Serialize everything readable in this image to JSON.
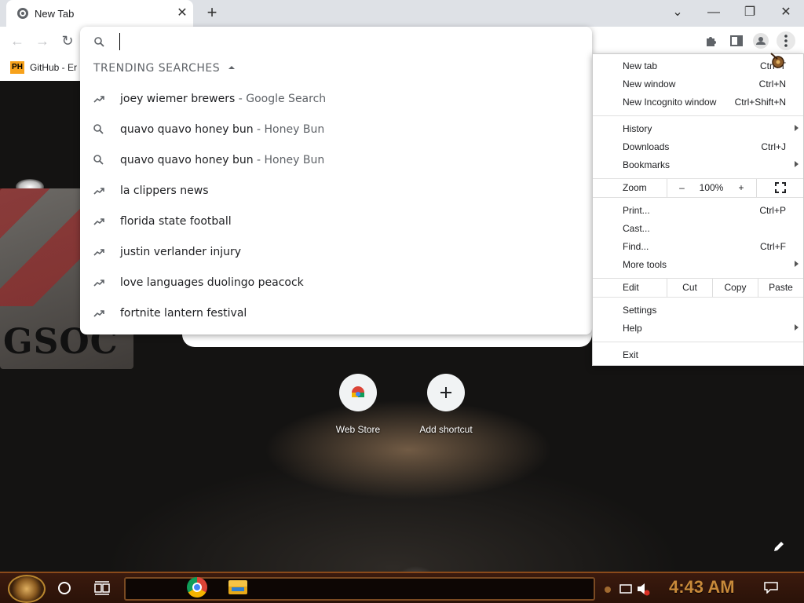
{
  "browser": {
    "tab": {
      "title": "New Tab",
      "close": "✕"
    },
    "new_tab_button": "+",
    "window_controls": {
      "tab_search": "⌄",
      "minimize": "—",
      "restore": "❐",
      "close": "✕"
    },
    "nav": {
      "back": "←",
      "forward": "→",
      "reload": "↻"
    },
    "bookmarks": [
      {
        "favicon_text": "PH",
        "label": "GitHub - Er"
      }
    ]
  },
  "omnibox": {
    "input_value": "",
    "heading": "TRENDING SEARCHES",
    "suggestions": [
      {
        "icon": "trending-icon",
        "text": "joey wiemer brewers",
        "description": " - Google Search"
      },
      {
        "icon": "search-icon",
        "text": "quavo quavo honey bun",
        "description": " - Honey Bun"
      },
      {
        "icon": "search-icon",
        "text": "quavo quavo honey bun",
        "description": " - Honey Bun"
      },
      {
        "icon": "trending-icon",
        "text": "la clippers news",
        "description": ""
      },
      {
        "icon": "trending-icon",
        "text": "florida state football",
        "description": ""
      },
      {
        "icon": "trending-icon",
        "text": "justin verlander injury",
        "description": ""
      },
      {
        "icon": "trending-icon",
        "text": "love languages duolingo peacock",
        "description": ""
      },
      {
        "icon": "trending-icon",
        "text": "fortnite lantern festival",
        "description": ""
      }
    ]
  },
  "new_tab_page": {
    "search_peek_text": "",
    "shortcuts": [
      {
        "label": "Web Store",
        "icon": "web-store-icon"
      },
      {
        "label": "Add shortcut",
        "icon": "plus-icon"
      }
    ],
    "wallpaper_text": "GSOC"
  },
  "menu": {
    "new_tab": {
      "label": "New tab",
      "shortcut": "Ctrl+T"
    },
    "new_window": {
      "label": "New window",
      "shortcut": "Ctrl+N"
    },
    "incognito": {
      "label": "New Incognito window",
      "shortcut": "Ctrl+Shift+N"
    },
    "history": {
      "label": "History"
    },
    "downloads": {
      "label": "Downloads",
      "shortcut": "Ctrl+J"
    },
    "bookmarks": {
      "label": "Bookmarks"
    },
    "zoom": {
      "label": "Zoom",
      "minus": "–",
      "value": "100%",
      "plus": "+"
    },
    "print": {
      "label": "Print...",
      "shortcut": "Ctrl+P"
    },
    "cast": {
      "label": "Cast..."
    },
    "find": {
      "label": "Find...",
      "shortcut": "Ctrl+F"
    },
    "more_tools": {
      "label": "More tools"
    },
    "edit": {
      "label": "Edit",
      "cut": "Cut",
      "copy": "Copy",
      "paste": "Paste"
    },
    "settings": {
      "label": "Settings"
    },
    "help": {
      "label": "Help"
    },
    "exit": {
      "label": "Exit"
    }
  },
  "taskbar": {
    "clock": "4:43 AM"
  }
}
